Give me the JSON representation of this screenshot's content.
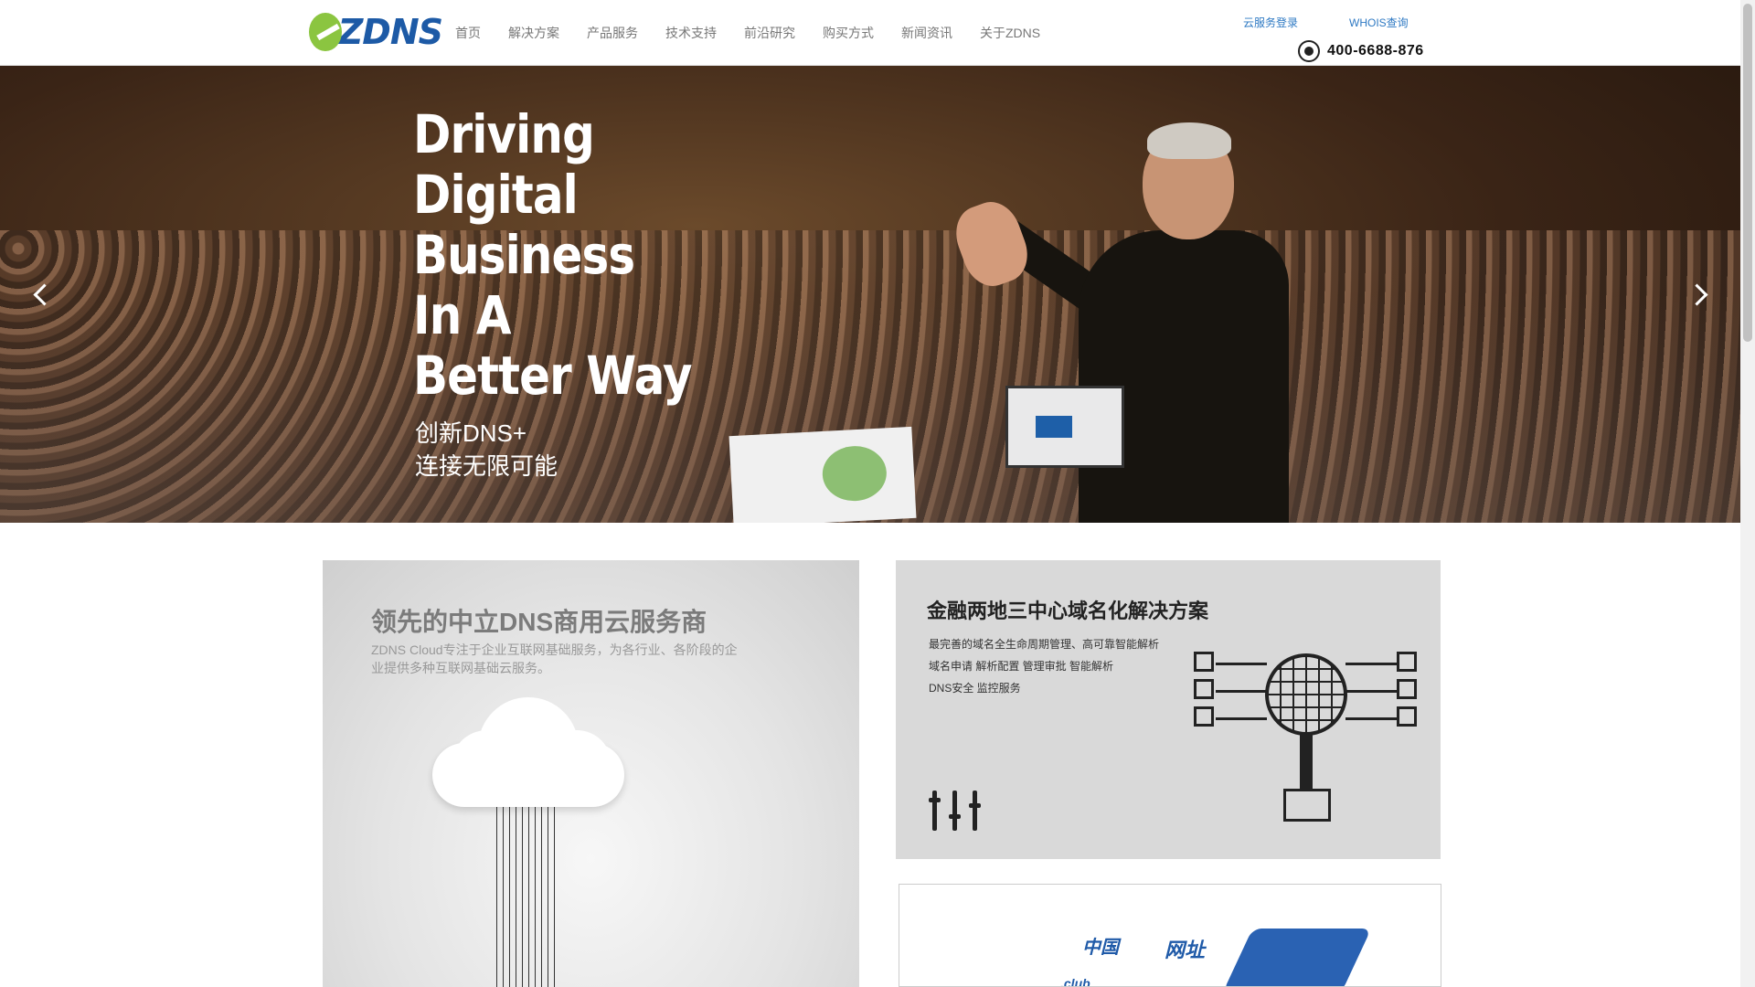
{
  "header": {
    "logo_text": "ZDNS",
    "nav": [
      "首页",
      "解决方案",
      "产品服务",
      "技术支持",
      "前沿研究",
      "购买方式",
      "新闻资讯",
      "关于ZDNS"
    ],
    "top_links": [
      "云服务登录",
      "WHOIS查询"
    ],
    "phone": "400-6688-876"
  },
  "hero": {
    "headline_lines": [
      "Driving",
      "Digital",
      "Business",
      "In A",
      "Better Way"
    ],
    "sub_lines": [
      "创新DNS+",
      "连接无限可能"
    ],
    "prev_icon": "chevron-left-icon",
    "next_icon": "chevron-right-icon"
  },
  "card_left": {
    "title": "领先的中立DNS商用云服务商",
    "desc": "ZDNS Cloud专注于企业互联网基础服务，为各行业、各阶段的企业提供多种互联网基础云服务。"
  },
  "card_right": {
    "title": "金融两地三中心域名化解决方案",
    "lines": [
      "最完善的域名全生命周期管理、高可靠智能解析",
      "域名申请  解析配置  管理审批  智能解析",
      "DNS安全  监控服务"
    ]
  },
  "card_bottom": {
    "art_words": [
      "中国",
      "网址",
      ".club"
    ]
  },
  "colors": {
    "accent_blue": "#2e79c3",
    "logo_green": "#8bc540",
    "logo_blue": "#1d5aa6"
  }
}
